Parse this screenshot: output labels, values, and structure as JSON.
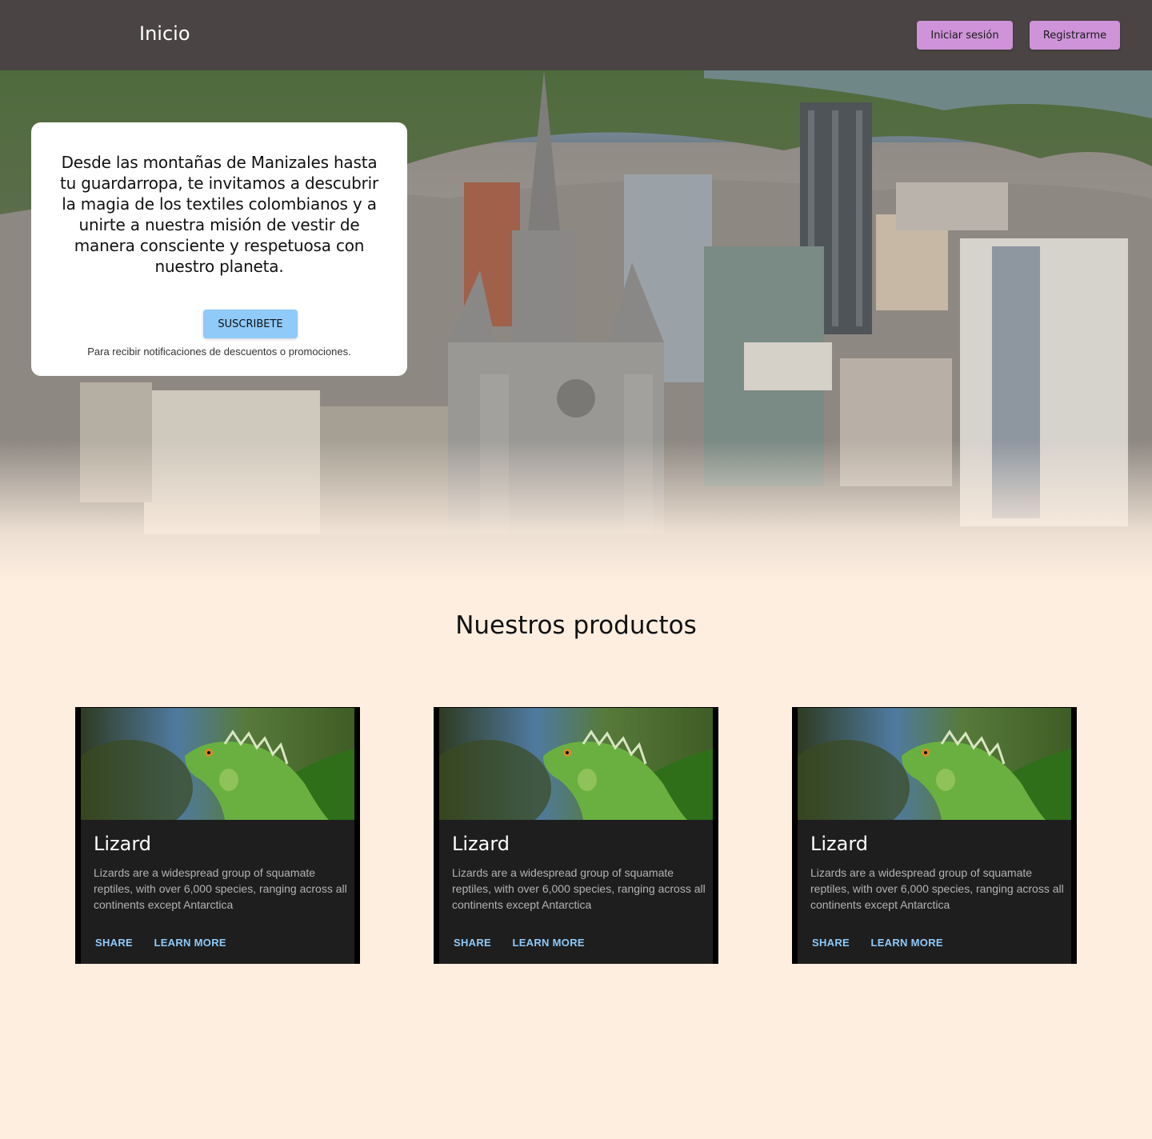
{
  "header": {
    "title": "Inicio",
    "login_label": "Iniciar sesión",
    "register_label": "Registrarme"
  },
  "hero": {
    "text": "Desde las montañas de Manizales hasta tu guardarropa, te invitamos a descubrir la magia de los textiles colombianos y a unirte a nuestra misión de vestir de manera consciente y respetuosa con nuestro planeta.",
    "subscribe_label": "SUSCRIBETE",
    "subscribe_note": "Para recibir notificaciones de descuentos o promociones."
  },
  "products": {
    "title": "Nuestros productos",
    "cards": [
      {
        "title": "Lizard",
        "description": "Lizards are a widespread group of squamate reptiles, with over 6,000 species, ranging across all continents except Antarctica",
        "share_label": "Share",
        "learn_label": "Learn More"
      },
      {
        "title": "Lizard",
        "description": "Lizards are a widespread group of squamate reptiles, with over 6,000 species, ranging across all continents except Antarctica",
        "share_label": "Share",
        "learn_label": "Learn More"
      },
      {
        "title": "Lizard",
        "description": "Lizards are a widespread group of squamate reptiles, with over 6,000 species, ranging across all continents except Antarctica",
        "share_label": "Share",
        "learn_label": "Learn More"
      }
    ]
  },
  "colors": {
    "header_bg": "#4a4544",
    "button_accent": "#ce93d8",
    "subscribe_accent": "#90caf9",
    "page_bg": "#fdeee0",
    "card_bg": "#1e1e1e"
  }
}
